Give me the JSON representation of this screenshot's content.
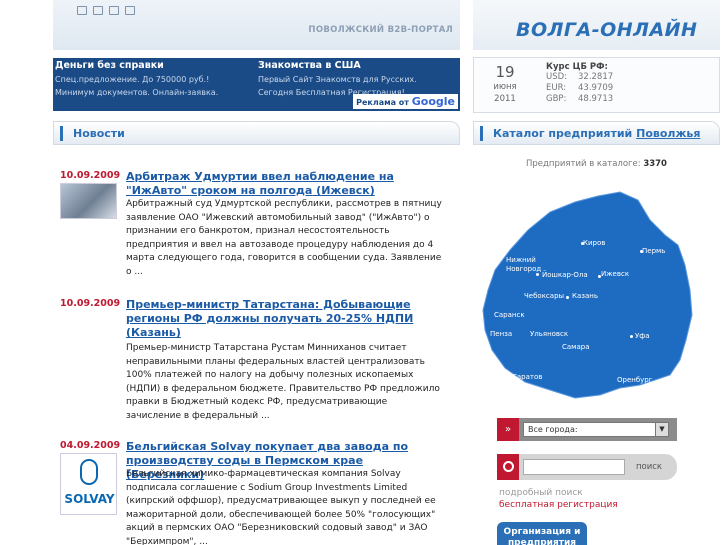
{
  "header": {
    "portal": "ПОВОЛЖСКИЙ B2B-ПОРТАЛ",
    "brand": "ВОЛГА-ОНЛАЙН",
    "icons": [
      "home-icon",
      "sitemap-icon",
      "mail-icon",
      "search-icon"
    ]
  },
  "ads": [
    {
      "title": "Деньги без справки",
      "text": "Спец.предложение. До 750000 руб.! Минимум документов. Онлайн-заявка."
    },
    {
      "title": "Знакомства в США",
      "text": "Первый Сайт Знакомств для Русских. Сегодня Бесплатная Регистрация!"
    }
  ],
  "ads_label": "Реклама от",
  "ads_google": "Google",
  "date": {
    "day": "19",
    "month": "июня",
    "year": "2011"
  },
  "rates": {
    "title": "Курс ЦБ РФ:",
    "items": [
      {
        "cur": "USD:",
        "val": "32.2817"
      },
      {
        "cur": "EUR:",
        "val": "43.9709"
      },
      {
        "cur": "GBP:",
        "val": "48.9713"
      }
    ]
  },
  "news": {
    "title": "Новости",
    "items": [
      {
        "date": "10.09.2009",
        "title": "Арбитраж Удмуртии ввел наблюдение на \"ИжАвто\" сроком на полгода",
        "geo": "Ижевск",
        "body": "Арбитражный суд Удмуртской республики, рассмотрев в пятницу заявление ОАО \"Ижевский автомобильный завод\" (\"ИжАвто\") о признании его банкротом, признал несостоятельность предприятия и ввел на автозаводе процедуру наблюдения до 4 марта следующего года, говорится в сообщении суда. Заявление о ..."
      },
      {
        "date": "10.09.2009",
        "title": "Премьер-министр Татарстана: Добывающие регионы РФ должны получать 20-25% НДПИ",
        "geo": "Казань",
        "body": "Премьер-министр Татарстана Рустам Минниханов считает неправильными планы федеральных властей централизовать 100% платежей по налогу на добычу полезных ископаемых (НДПИ) в федеральном бюджете. Правительство РФ предложило правки в Бюджетный кодекс РФ, предусматривающие зачисление в федеральный ..."
      },
      {
        "date": "04.09.2009",
        "title": "Бельгийская Solvay покупает два завода по производству соды в Пермском крае",
        "geo": "Березники",
        "logo": "SOLVAY",
        "body": "Бельгийская химико-фармацевтическая компания Solvay подписала соглашение с Sodium Group Investments Limited (кипрский оффшор), предусматривающее выкуп у последней ее мажоритарной доли, обеспечивающей более 50% \"голосующих\" акций в пермских ОАО \"Березниковский содовый завод\" и ЗАО \"Берхимпром\", ..."
      }
    ]
  },
  "catalog": {
    "title": "Каталог предприятий",
    "title_hl": "Поволжья",
    "count_label": "Предприятий в каталоге:",
    "count": "3370",
    "cities": [
      "Киров",
      "Пермь",
      "Нижний Новгород",
      "Йошкар-Ола",
      "Ижевск",
      "Чебоксары",
      "Казань",
      "Саранск",
      "Пенза",
      "Ульяновск",
      "Уфа",
      "Самара",
      "Оренбург",
      "Саратов"
    ],
    "map_color": "#1e6cc2"
  },
  "city_select": {
    "arrow": "»",
    "value": "Все города:"
  },
  "search": {
    "button": "поиск",
    "advanced": "подробный поиск",
    "register": "бесплатная регистрация"
  },
  "org_button": "Организация и предприятия"
}
